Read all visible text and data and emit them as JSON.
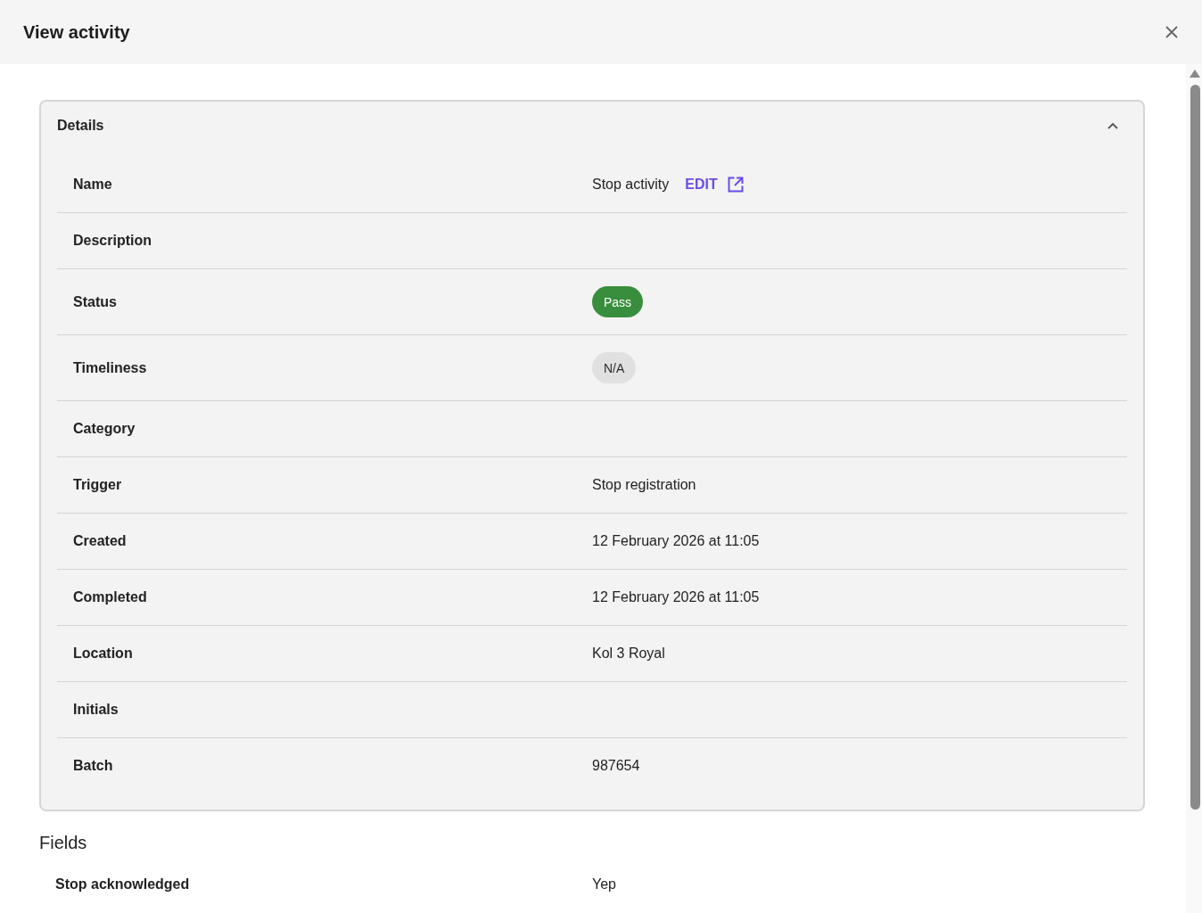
{
  "window": {
    "title": "View activity"
  },
  "details": {
    "title": "Details",
    "expanded": true,
    "rows": [
      {
        "kind": "text",
        "label": "Name",
        "value": "Stop activity",
        "link": "EDIT"
      },
      {
        "kind": "text",
        "label": "Description"
      },
      {
        "kind": "chip",
        "label": "Status",
        "value": "Pass",
        "color": "#388e3c"
      },
      {
        "kind": "chip",
        "label": "Timeliness",
        "value": "N/A",
        "color": "#e0e0e0"
      },
      {
        "kind": "text",
        "label": "Category"
      },
      {
        "kind": "text",
        "label": "Trigger",
        "value": "Stop registration"
      },
      {
        "kind": "text",
        "label": "Created",
        "value": "12 February 2026 at 11:05"
      },
      {
        "kind": "text",
        "label": "Completed",
        "value": "12 February 2026 at 11:05"
      },
      {
        "kind": "text",
        "label": "Location",
        "value": "Kol 3 Royal"
      },
      {
        "kind": "text",
        "label": "Initials"
      },
      {
        "kind": "text",
        "label": "Batch",
        "value": "987654"
      }
    ]
  },
  "fields": {
    "title": "Fields",
    "rows": [
      {
        "label": "Stop acknowledged",
        "value": "Yep"
      }
    ]
  }
}
